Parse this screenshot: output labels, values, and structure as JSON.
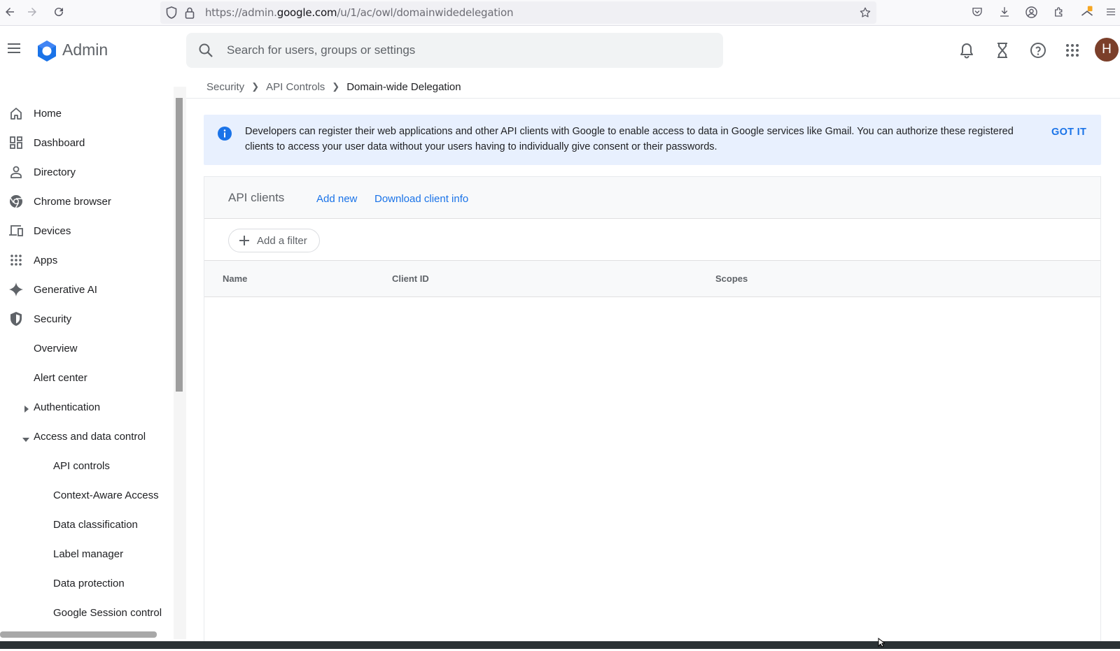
{
  "browser": {
    "url_prefix": "https://admin.",
    "url_domain": "google.com",
    "url_path": "/u/1/ac/owl/domainwidedelegation"
  },
  "header": {
    "logo_text": "Admin",
    "search_placeholder": "Search for users, groups or settings",
    "avatar_initial": "H"
  },
  "sidebar": {
    "items": [
      {
        "label": "Home",
        "icon": "home-icon"
      },
      {
        "label": "Dashboard",
        "icon": "dashboard-icon"
      },
      {
        "label": "Directory",
        "icon": "person-icon"
      },
      {
        "label": "Chrome browser",
        "icon": "chrome-icon"
      },
      {
        "label": "Devices",
        "icon": "devices-icon"
      },
      {
        "label": "Apps",
        "icon": "apps-grid-icon"
      },
      {
        "label": "Generative AI",
        "icon": "sparkle-icon"
      },
      {
        "label": "Security",
        "icon": "shield-icon"
      },
      {
        "label": "Overview"
      },
      {
        "label": "Alert center"
      },
      {
        "label": "Authentication"
      },
      {
        "label": "Access and data control"
      },
      {
        "label": "API controls"
      },
      {
        "label": "Context-Aware Access"
      },
      {
        "label": "Data classification"
      },
      {
        "label": "Label manager"
      },
      {
        "label": "Data protection"
      },
      {
        "label": "Google Session control"
      }
    ]
  },
  "breadcrumb": {
    "items": [
      "Security",
      "API Controls"
    ],
    "current": "Domain-wide Delegation"
  },
  "banner": {
    "text": "Developers can register their web applications and other API clients with Google to enable access to data in Google services like Gmail. You can authorize these registered clients to access your user data without your users having to individually give consent or their passwords.",
    "action": "GOT IT"
  },
  "api_clients": {
    "title": "API clients",
    "add_new": "Add new",
    "download": "Download client info",
    "filter": "Add a filter",
    "columns": [
      "Name",
      "Client ID",
      "Scopes"
    ]
  },
  "colors": {
    "accent": "#1a73e8",
    "banner_bg": "#e8f0fe",
    "avatar_bg": "#7b3f2a"
  }
}
